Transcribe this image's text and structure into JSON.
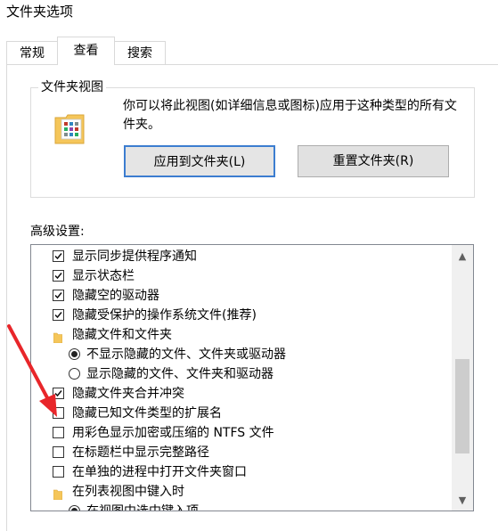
{
  "window": {
    "title": "文件夹选项"
  },
  "tabs": [
    {
      "label": "常规"
    },
    {
      "label": "查看"
    },
    {
      "label": "搜索"
    }
  ],
  "folder_views": {
    "group_label": "文件夹视图",
    "description": "你可以将此视图(如详细信息或图标)应用于这种类型的所有文件夹。",
    "apply_button": "应用到文件夹(L)",
    "reset_button": "重置文件夹(R)"
  },
  "advanced": {
    "label": "高级设置:",
    "items": [
      {
        "type": "checkbox",
        "checked": true,
        "indent": 0,
        "label": "显示同步提供程序通知"
      },
      {
        "type": "checkbox",
        "checked": true,
        "indent": 0,
        "label": "显示状态栏"
      },
      {
        "type": "checkbox",
        "checked": true,
        "indent": 0,
        "label": "隐藏空的驱动器"
      },
      {
        "type": "checkbox",
        "checked": true,
        "indent": 0,
        "label": "隐藏受保护的操作系统文件(推荐)"
      },
      {
        "type": "folder",
        "indent": 0,
        "label": "隐藏文件和文件夹"
      },
      {
        "type": "radio",
        "checked": true,
        "indent": 1,
        "label": "不显示隐藏的文件、文件夹或驱动器"
      },
      {
        "type": "radio",
        "checked": false,
        "indent": 1,
        "label": "显示隐藏的文件、文件夹和驱动器"
      },
      {
        "type": "checkbox",
        "checked": true,
        "indent": 0,
        "label": "隐藏文件夹合并冲突"
      },
      {
        "type": "checkbox",
        "checked": false,
        "indent": 0,
        "label": "隐藏已知文件类型的扩展名"
      },
      {
        "type": "checkbox",
        "checked": false,
        "indent": 0,
        "label": "用彩色显示加密或压缩的 NTFS 文件"
      },
      {
        "type": "checkbox",
        "checked": false,
        "indent": 0,
        "label": "在标题栏中显示完整路径"
      },
      {
        "type": "checkbox",
        "checked": false,
        "indent": 0,
        "label": "在单独的进程中打开文件夹窗口"
      },
      {
        "type": "folder",
        "indent": 0,
        "label": "在列表视图中键入时"
      },
      {
        "type": "radio",
        "checked": true,
        "indent": 1,
        "label": "在视图中选中键入项"
      }
    ]
  },
  "colors": {
    "accent": "#3c7dd0",
    "annotation": "#e8262a",
    "folder": "#f5c65a"
  }
}
